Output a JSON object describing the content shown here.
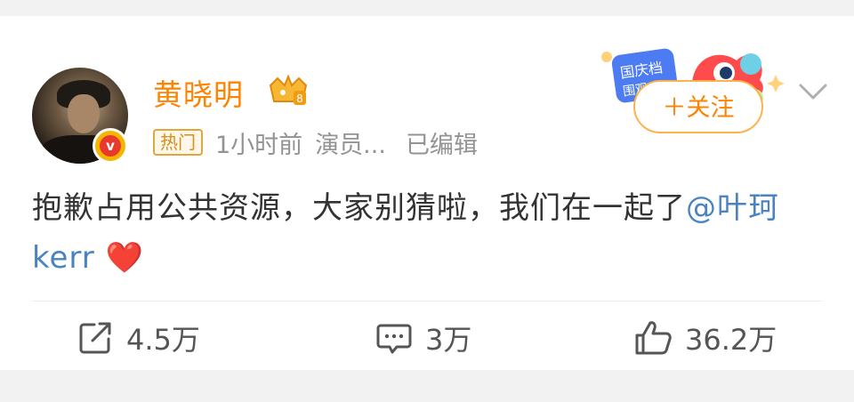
{
  "post": {
    "username": "黄晓明",
    "hot_tag": "热门",
    "time": "1小时前",
    "identity": "演员...",
    "edited": "已编辑",
    "follow_label": "＋关注",
    "text_main": "抱歉占用公共资源，大家别猜啦，我们在一起了",
    "mention": "@叶珂kerr",
    "emoji": "❤️",
    "banner_text_1": "国庆档",
    "banner_text_2": "围观"
  },
  "actions": {
    "repost": "4.5万",
    "comment": "3万",
    "like": "36.2万"
  },
  "icons": {
    "verified": "v-verified-badge",
    "crown": "crown-vip-icon",
    "more": "chevron-down-icon",
    "repost": "share-icon",
    "comment": "comment-icon",
    "like": "thumbs-up-icon"
  },
  "colors": {
    "username": "#ff8200",
    "mention": "#4a83c1",
    "meta": "#939393",
    "follow_border": "#ffb24a"
  }
}
